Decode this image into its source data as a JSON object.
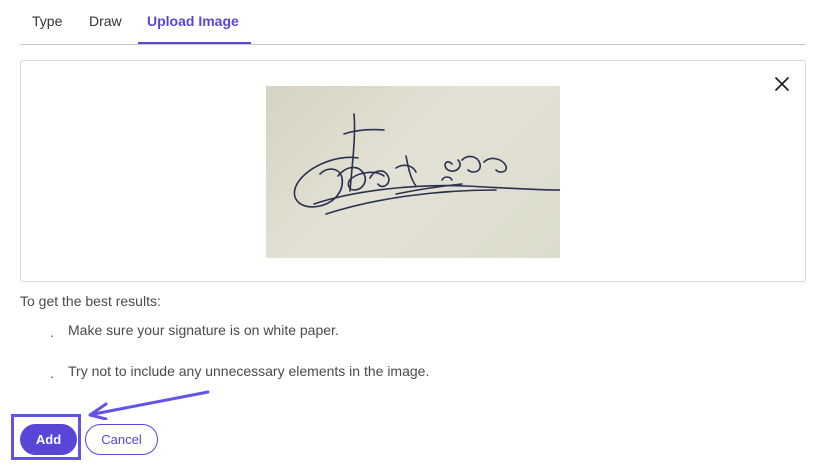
{
  "tabs": [
    {
      "label": "Type",
      "active": false
    },
    {
      "label": "Draw",
      "active": false
    },
    {
      "label": "Upload Image",
      "active": true
    }
  ],
  "upload": {
    "close_icon": "close-icon"
  },
  "tips": {
    "heading": "To get the best results:",
    "bullet": ".",
    "items": [
      "Make sure your signature is on white paper.",
      "Try not to include any unnecessary elements in the image."
    ]
  },
  "actions": {
    "add_label": "Add",
    "cancel_label": "Cancel"
  },
  "colors": {
    "accent": "#5a46d6",
    "highlight": "#6253e8",
    "paper": "#dcdacb",
    "ink": "#2a3050"
  }
}
